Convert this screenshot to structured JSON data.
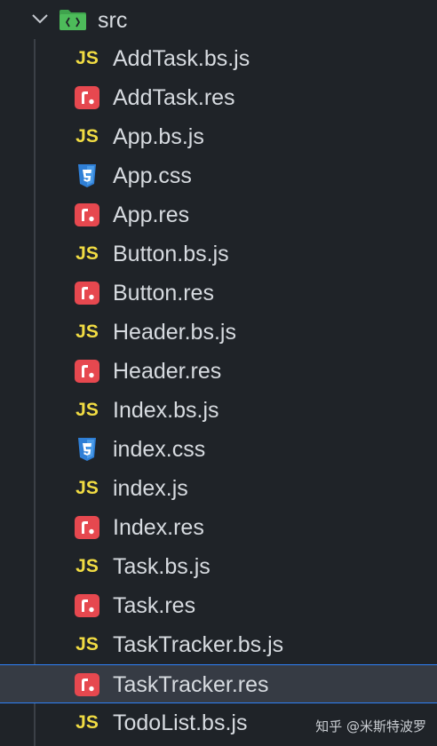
{
  "folder": {
    "name": "src",
    "icon": "folder-src-icon",
    "expanded": true
  },
  "files": [
    {
      "name": "AddTask.bs.js",
      "icon": "javascript-icon",
      "selected": false
    },
    {
      "name": "AddTask.res",
      "icon": "rescript-icon",
      "selected": false
    },
    {
      "name": "App.bs.js",
      "icon": "javascript-icon",
      "selected": false
    },
    {
      "name": "App.css",
      "icon": "css-icon",
      "selected": false
    },
    {
      "name": "App.res",
      "icon": "rescript-icon",
      "selected": false
    },
    {
      "name": "Button.bs.js",
      "icon": "javascript-icon",
      "selected": false
    },
    {
      "name": "Button.res",
      "icon": "rescript-icon",
      "selected": false
    },
    {
      "name": "Header.bs.js",
      "icon": "javascript-icon",
      "selected": false
    },
    {
      "name": "Header.res",
      "icon": "rescript-icon",
      "selected": false
    },
    {
      "name": "Index.bs.js",
      "icon": "javascript-icon",
      "selected": false
    },
    {
      "name": "index.css",
      "icon": "css-icon",
      "selected": false
    },
    {
      "name": "index.js",
      "icon": "javascript-icon",
      "selected": false
    },
    {
      "name": "Index.res",
      "icon": "rescript-icon",
      "selected": false
    },
    {
      "name": "Task.bs.js",
      "icon": "javascript-icon",
      "selected": false
    },
    {
      "name": "Task.res",
      "icon": "rescript-icon",
      "selected": false
    },
    {
      "name": "TaskTracker.bs.js",
      "icon": "javascript-icon",
      "selected": false
    },
    {
      "name": "TaskTracker.res",
      "icon": "rescript-icon",
      "selected": true
    },
    {
      "name": "TodoList.bs.js",
      "icon": "javascript-icon",
      "selected": false
    }
  ],
  "icon_labels": {
    "js": "JS",
    "css": "3"
  },
  "colors": {
    "background": "#1f2328",
    "selected_row": "#363b44",
    "selection_border": "#2f81f7",
    "js_yellow": "#f1dc43",
    "rescript_red": "#e6484f",
    "css_blue": "#2f7fd6",
    "folder_green": "#3fa34d"
  },
  "watermark": "知乎 @米斯特波罗"
}
